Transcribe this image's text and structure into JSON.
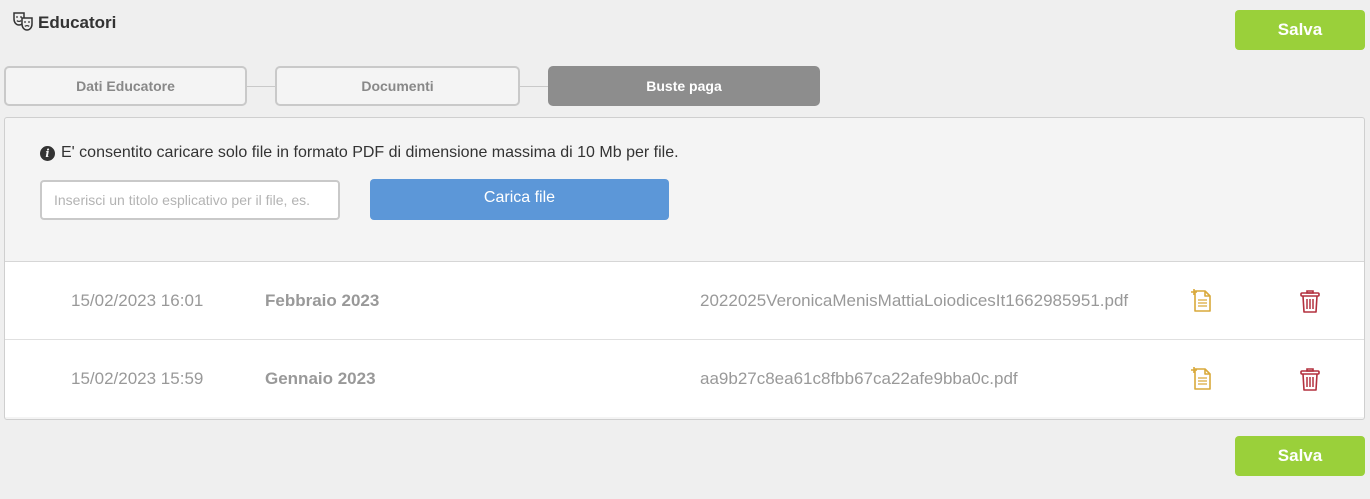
{
  "header": {
    "title": "Educatori",
    "save_label": "Salva"
  },
  "tabs": [
    {
      "label": "Dati Educatore",
      "active": false
    },
    {
      "label": "Documenti",
      "active": false
    },
    {
      "label": "Buste paga",
      "active": true
    }
  ],
  "upload": {
    "info_text": "E' consentito caricare solo file in formato PDF di dimensione massima di 10 Mb per file.",
    "title_value": "",
    "title_placeholder": "Inserisci un titolo esplicativo per il file, es.",
    "button_label": "Carica file"
  },
  "files": [
    {
      "date": "15/02/2023 16:01",
      "title": "Febbraio 2023",
      "filename": "2022025VeronicaMenisMattiaLoiodicesIt1662985951.pdf",
      "open_icon": "document-icon",
      "delete_icon": "trash-icon"
    },
    {
      "date": "15/02/2023 15:59",
      "title": "Gennaio 2023",
      "filename": "aa9b27c8ea61c8fbb67ca22afe9bba0c.pdf",
      "open_icon": "document-icon",
      "delete_icon": "trash-icon"
    }
  ],
  "footer": {
    "save_label": "Salva"
  },
  "colors": {
    "save": "#9ad03a",
    "upload": "#5c97d8",
    "active_tab": "#8d8d8d",
    "doc_icon": "#d9a93a",
    "trash_icon": "#b3303e"
  }
}
